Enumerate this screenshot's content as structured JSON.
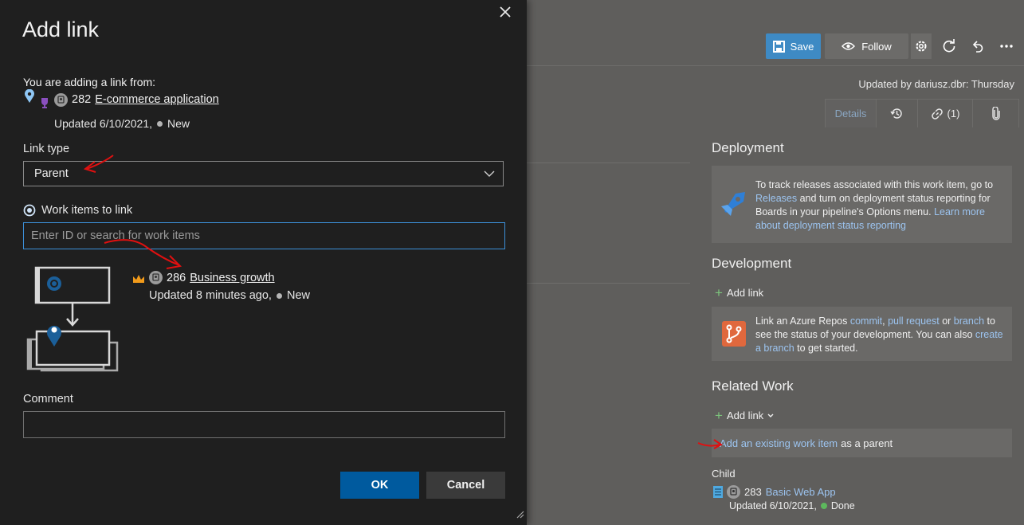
{
  "background": {
    "toolbar": {
      "save_label": "Save",
      "follow_label": "Follow"
    },
    "updated_by": "Updated by dariusz.dbr: Thursday",
    "tabs": [
      {
        "label": "Details"
      },
      {
        "icon": "history-icon"
      },
      {
        "icon": "link-icon",
        "label": "(1)"
      },
      {
        "icon": "attachment-icon"
      }
    ],
    "deployment": {
      "title": "Deployment",
      "text_1": "To track releases associated with this work item, go to",
      "link_releases": "Releases",
      "text_2": "and turn on deployment status reporting for Boards in your pipeline's Options menu.",
      "link_learn": "Learn more about deployment status reporting"
    },
    "development": {
      "title": "Development",
      "add_link": "Add link",
      "text_1": "Link an Azure Repos",
      "link_commit": "commit",
      "link_pr": "pull request",
      "or": "or",
      "link_branch": "branch",
      "text_2": "to see the status of your development. You can also",
      "link_create": "create a branch",
      "text_3": "to get started."
    },
    "related_work": {
      "title": "Related Work",
      "add_link": "Add link",
      "existing_link": "Add an existing work item",
      "existing_suffix": "as a parent",
      "child_label": "Child",
      "child": {
        "id": "283",
        "title": "Basic Web App",
        "updated": "Updated 6/10/2021,",
        "state": "Done",
        "state_color": "#5db85d"
      }
    }
  },
  "dialog": {
    "title": "Add link",
    "from_label": "You are adding a link from:",
    "from_item": {
      "id": "282",
      "title": "E-commerce application",
      "updated": "Updated 6/10/2021,",
      "state": "New"
    },
    "link_type_label": "Link type",
    "link_type_value": "Parent",
    "work_items_label": "Work items to link",
    "search_placeholder": "Enter ID or search for work items",
    "target_item": {
      "id": "286",
      "title": "Business growth",
      "updated": "Updated 8 minutes ago,",
      "state": "New"
    },
    "comment_label": "Comment",
    "ok_label": "OK",
    "cancel_label": "Cancel"
  },
  "colors": {
    "accent": "#005a9e",
    "save": "#3e8ac4",
    "link": "#9cc4f0",
    "annotation": "#e01010"
  }
}
